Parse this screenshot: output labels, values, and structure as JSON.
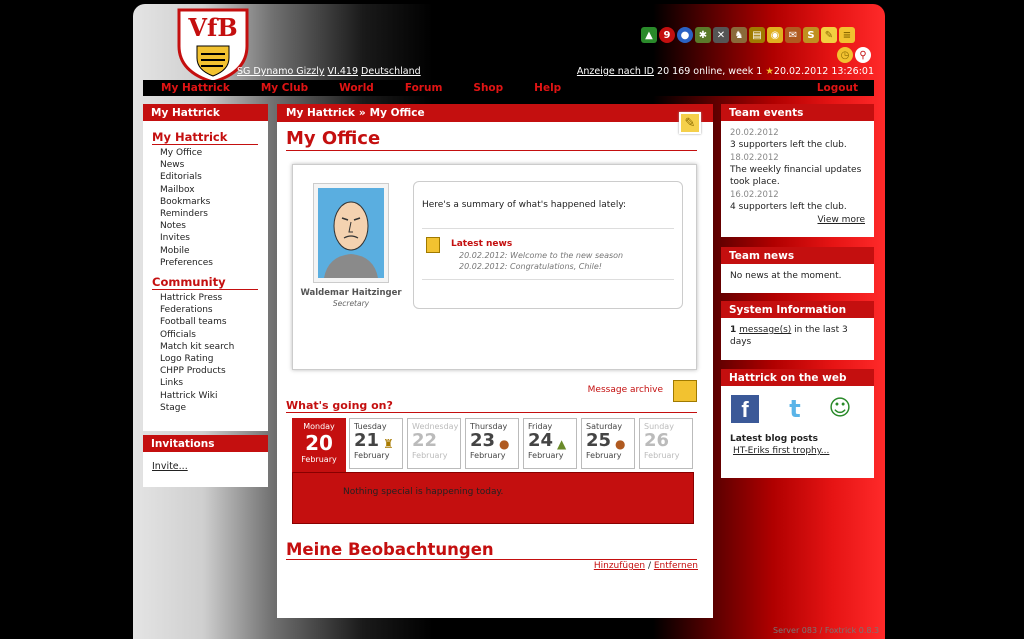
{
  "club": {
    "name": "SG Dynamo Gizzly",
    "league": "VI.419",
    "country": "Deutschland"
  },
  "status": {
    "lookup": "Anzeige nach ID",
    "online": "20 169 online, week 1",
    "datetime": "20.02.2012 13:26:01"
  },
  "nav": {
    "items": [
      "My Hattrick",
      "My Club",
      "World",
      "Forum",
      "Shop",
      "Help"
    ],
    "logout": "Logout"
  },
  "left": {
    "header": "My Hattrick",
    "section1": "My Hattrick",
    "items1": [
      "My Office",
      "News",
      "Editorials",
      "Mailbox",
      "Bookmarks",
      "Reminders",
      "Notes",
      "Invites",
      "Mobile",
      "Preferences"
    ],
    "section2": "Community",
    "items2": [
      "Hattrick Press",
      "Federations",
      "Football teams",
      "Officials",
      "Match kit search",
      "Logo Rating",
      "CHPP Products",
      "Links",
      "Hattrick Wiki",
      "Stage"
    ]
  },
  "invitations": {
    "header": "Invitations",
    "link": "Invite..."
  },
  "main": {
    "crumb1": "My Hattrick",
    "crumb_sep": "»",
    "crumb2": "My Office",
    "title": "My Office",
    "secretary": {
      "name": "Waldemar Haitzinger",
      "role": "Secretary"
    },
    "summary": "Here's a summary of what's happened lately:",
    "latest_news": "Latest news",
    "news": [
      "20.02.2012: Welcome to the new season",
      "20.02.2012: Congratulations, Chile!"
    ],
    "message_archive": "Message archive",
    "whats_going_on": "What's going on?",
    "calendar": [
      {
        "day": "Monday",
        "num": "20",
        "month": "February"
      },
      {
        "day": "Tuesday",
        "num": "21",
        "month": "February"
      },
      {
        "day": "Wednesday",
        "num": "22",
        "month": "February"
      },
      {
        "day": "Thursday",
        "num": "23",
        "month": "February"
      },
      {
        "day": "Friday",
        "num": "24",
        "month": "February"
      },
      {
        "day": "Saturday",
        "num": "25",
        "month": "February"
      },
      {
        "day": "Sunday",
        "num": "26",
        "month": "February"
      }
    ],
    "nothing": "Nothing special is happening today.",
    "watch_title": "Meine Beobachtungen",
    "add": "Hinzufügen",
    "slash": "/",
    "remove": "Entfernen"
  },
  "team_events": {
    "header": "Team events",
    "items": [
      {
        "date": "20.02.2012",
        "text": "3 supporters left the club."
      },
      {
        "date": "18.02.2012",
        "text": "The weekly financial updates took place."
      },
      {
        "date": "16.02.2012",
        "text": "4 supporters left the club."
      }
    ],
    "view_more": "View more"
  },
  "team_news": {
    "header": "Team news",
    "text": "No news at the moment."
  },
  "system_info": {
    "header": "System Information",
    "count": "1",
    "link": "message(s)",
    "suffix": " in the last 3 days"
  },
  "web": {
    "header": "Hattrick on the web",
    "blog": "Latest blog posts",
    "post": "HT-Eriks first trophy..."
  },
  "server": "Server 083 / Foxtrick 0.8.3",
  "colors": {
    "accent": "#c40f0f",
    "nav_text": "#e01414"
  }
}
